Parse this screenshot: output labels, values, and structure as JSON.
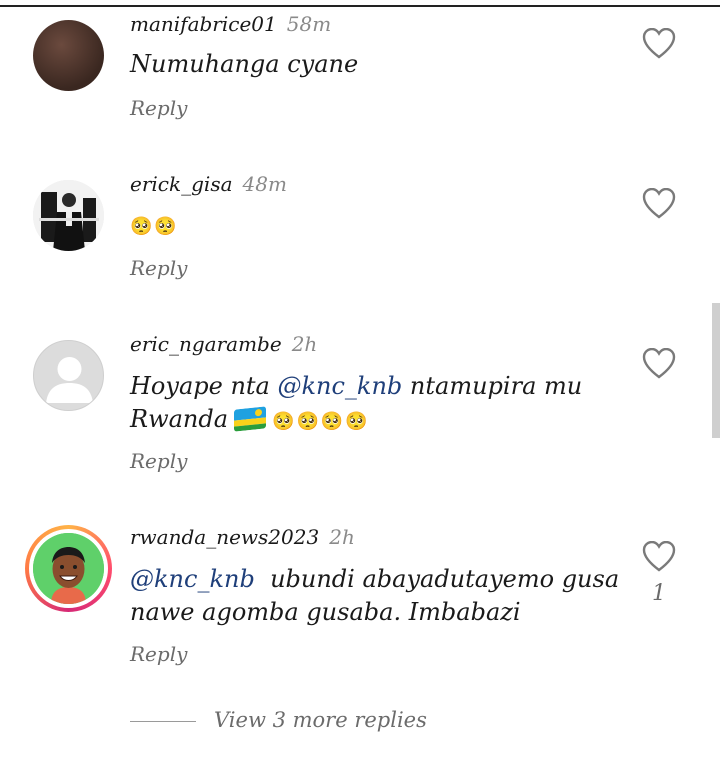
{
  "icons": {
    "like": "heart-outline-icon"
  },
  "colors": {
    "mention": "#1f3f7a",
    "meta_time": "#8a8a8a",
    "reply": "#6b6b6b",
    "emoji": "#e040c0"
  },
  "comments": [
    {
      "username": "manifabrice01",
      "time": "58m",
      "text": "Numuhanga cyane",
      "reply_label": "Reply"
    },
    {
      "username": "erick_gisa",
      "time": "48m",
      "emojis": "🥺🥺",
      "reply_label": "Reply"
    },
    {
      "username": "eric_ngarambe",
      "time": "2h",
      "text_before": "Hoyape nta ",
      "mention": "@knc_knb",
      "text_after": " ntamupira mu",
      "text_line2": "Rwanda",
      "emojis": "🥺🥺🥺🥺",
      "reply_label": "Reply"
    },
    {
      "username": "rwanda_news2023",
      "time": "2h",
      "mention": "@knc_knb",
      "text_after": "  ubundi abayadutayemo gusa",
      "text_line2": "nawe agomba gusaba. Imbabazi",
      "like_count": "1",
      "reply_label": "Reply"
    }
  ],
  "view_more": {
    "label": "View 3 more replies"
  }
}
